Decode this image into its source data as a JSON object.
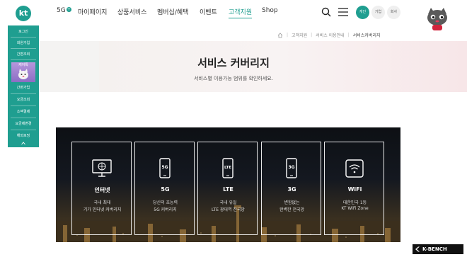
{
  "header": {
    "logo": "kt",
    "nav": {
      "n5g": "5G",
      "n5g_badge": "+",
      "mypage": "마이페이지",
      "products": "상품서비스",
      "membership": "멤버십/혜택",
      "event": "이벤트",
      "support": "고객지원",
      "shop": "Shop"
    },
    "segments": {
      "personal": "개인",
      "business": "기업",
      "corporate": "회사"
    }
  },
  "breadcrumb": {
    "items": [
      "고객지원",
      "서비스 이용안내",
      "서비스커버리지"
    ]
  },
  "page": {
    "title": "서비스 커버리지",
    "subtitle": "서비스별 이용가능 범위를 확인하세요."
  },
  "quick_menu": {
    "items": [
      "로그인",
      "회원가입",
      "간편조회",
      "케이톡",
      "간편가입",
      "요금조회",
      "소액결제",
      "요금제변경",
      "해외로밍"
    ]
  },
  "coverage": [
    {
      "title": "인터넷",
      "line1": "국내 최대",
      "line2": "기가 인터넷 커버리지",
      "icon": "globe-monitor-icon"
    },
    {
      "title": "5G",
      "line1": "당신의 초능력",
      "line2": "5G 커버리지",
      "icon": "phone-5g-icon",
      "icon_text": "5G"
    },
    {
      "title": "LTE",
      "line1": "국내 유일",
      "line2": "LTE 광대역 전국망",
      "icon": "phone-lte-icon",
      "icon_text": "LTE"
    },
    {
      "title": "3G",
      "line1": "변함없는",
      "line2": "완벽한 전국망",
      "icon": "phone-3g-icon",
      "icon_text": "3G"
    },
    {
      "title": "WiFi",
      "line1": "대한민국 1등",
      "line2": "KT WiFi Zone",
      "icon": "wifi-icon"
    }
  ],
  "watermark": "K-BENCH",
  "colors": {
    "brand": "#1f9e90"
  }
}
